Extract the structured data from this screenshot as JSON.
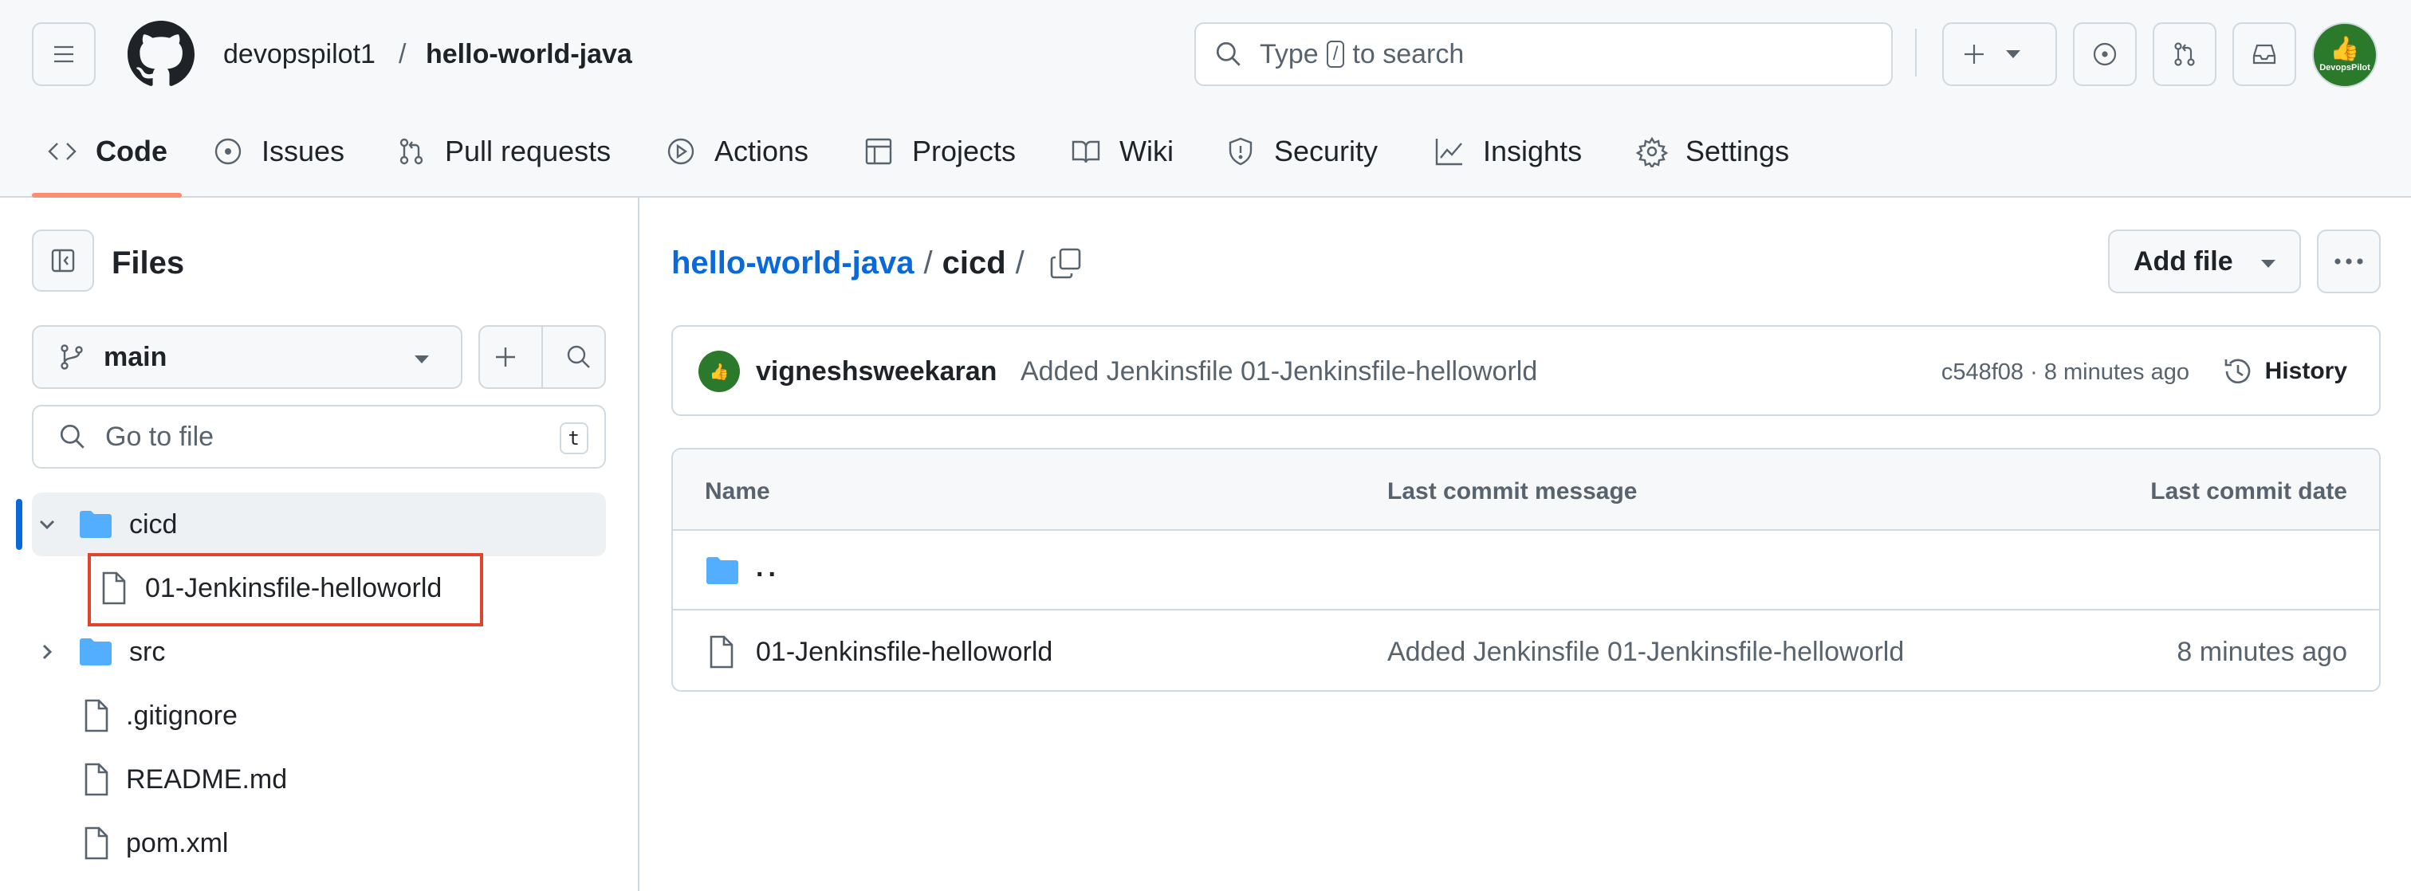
{
  "header": {
    "owner": "devopspilot1",
    "separator": "/",
    "repo": "hello-world-java",
    "search": {
      "prefix": "Type",
      "key": "/",
      "suffix": "to search"
    },
    "avatar_label": "DevopsPilot",
    "avatar_color": "#2b7a2b"
  },
  "tabs": [
    {
      "label": "Code",
      "icon": "code-icon",
      "selected": true
    },
    {
      "label": "Issues",
      "icon": "issue-icon"
    },
    {
      "label": "Pull requests",
      "icon": "pull-request-icon"
    },
    {
      "label": "Actions",
      "icon": "play-icon"
    },
    {
      "label": "Projects",
      "icon": "table-icon"
    },
    {
      "label": "Wiki",
      "icon": "book-icon"
    },
    {
      "label": "Security",
      "icon": "shield-icon"
    },
    {
      "label": "Insights",
      "icon": "graph-icon"
    },
    {
      "label": "Settings",
      "icon": "gear-icon"
    }
  ],
  "sidebar": {
    "title": "Files",
    "branch": "main",
    "goto_placeholder": "Go to file",
    "goto_shortcut": "t",
    "tree": [
      {
        "name": "cicd",
        "type": "folder",
        "expanded": true,
        "selected": true
      },
      {
        "name": "01-Jenkinsfile-helloworld",
        "type": "file",
        "highlighted": true
      },
      {
        "name": "src",
        "type": "folder",
        "expanded": false
      },
      {
        "name": ".gitignore",
        "type": "file"
      },
      {
        "name": "README.md",
        "type": "file"
      },
      {
        "name": "pom.xml",
        "type": "file"
      }
    ]
  },
  "main": {
    "breadcrumb": {
      "root": "hello-world-java",
      "sep": "/",
      "current": "cicd",
      "trail": "/"
    },
    "add_file_label": "Add file",
    "commit": {
      "author": "vigneshsweekaran",
      "message": "Added Jenkinsfile 01-Jenkinsfile-helloworld",
      "meta": "c548f08 · 8 minutes ago",
      "history_label": "History"
    },
    "table": {
      "headers": {
        "name": "Name",
        "message": "Last commit message",
        "date": "Last commit date"
      },
      "parent_row": "..",
      "rows": [
        {
          "name": "01-Jenkinsfile-helloworld",
          "message": "Added Jenkinsfile 01-Jenkinsfile-helloworld",
          "date": "8 minutes ago"
        }
      ]
    }
  },
  "colors": {
    "accent_link": "#0969da",
    "tab_underline": "#fd8c73",
    "highlight_box": "#e1432d",
    "folder": "#54aeff"
  }
}
